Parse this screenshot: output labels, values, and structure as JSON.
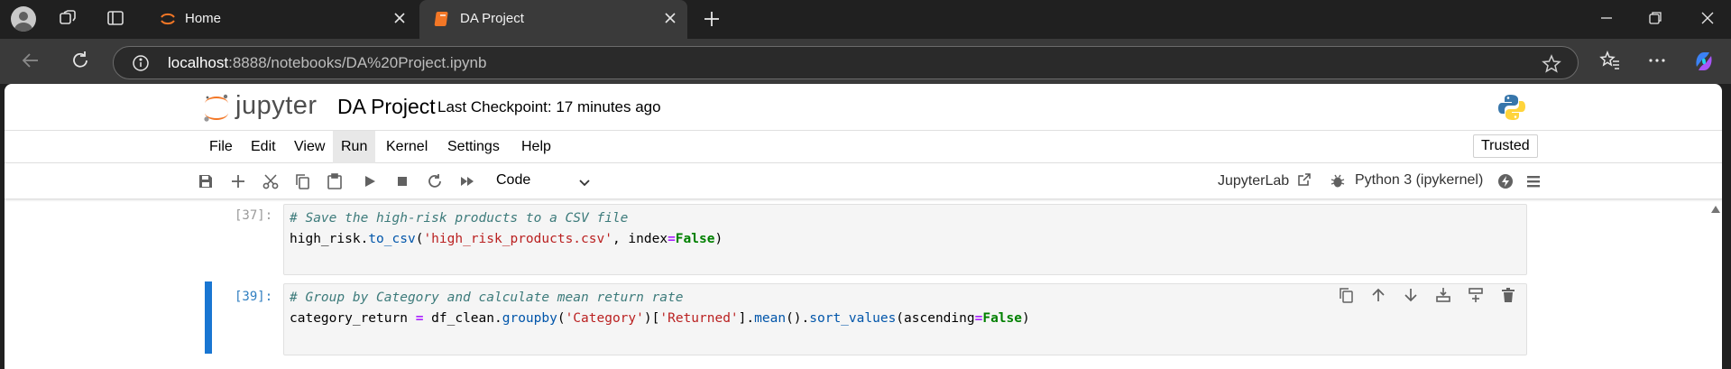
{
  "browser": {
    "tabs": [
      {
        "title": "Home"
      },
      {
        "title": "DA Project"
      }
    ],
    "url_host": "localhost",
    "url_rest": ":8888/notebooks/DA%20Project.ipynb"
  },
  "jupyter": {
    "logo_text": "jupyter",
    "notebook_title": "DA Project",
    "checkpoint": "Last Checkpoint: 17 minutes ago",
    "menu": [
      "File",
      "Edit",
      "View",
      "Run",
      "Kernel",
      "Settings",
      "Help"
    ],
    "trusted": "Trusted",
    "cell_type": "Code",
    "jupyterlab_link": "JupyterLab",
    "kernel": "Python 3 (ipykernel)"
  },
  "cells": [
    {
      "prompt": "[37]:",
      "lines": [
        [
          {
            "t": "# Save the high-risk products to a CSV file",
            "c": "comment"
          }
        ],
        [
          {
            "t": "high_risk",
            "c": ""
          },
          {
            "t": ".",
            "c": ""
          },
          {
            "t": "to_csv",
            "c": "attr"
          },
          {
            "t": "(",
            "c": ""
          },
          {
            "t": "'high_risk_products.csv'",
            "c": "str"
          },
          {
            "t": ", index",
            "c": ""
          },
          {
            "t": "=",
            "c": "op"
          },
          {
            "t": "False",
            "c": "kw"
          },
          {
            "t": ")",
            "c": ""
          }
        ]
      ]
    },
    {
      "prompt": "[39]:",
      "lines": [
        [
          {
            "t": "# Group by Category and calculate mean return rate",
            "c": "comment"
          }
        ],
        [
          {
            "t": "category_return ",
            "c": ""
          },
          {
            "t": "=",
            "c": "op"
          },
          {
            "t": " df_clean",
            "c": ""
          },
          {
            "t": ".",
            "c": ""
          },
          {
            "t": "groupby",
            "c": "attr"
          },
          {
            "t": "(",
            "c": ""
          },
          {
            "t": "'Category'",
            "c": "str"
          },
          {
            "t": ")[",
            "c": ""
          },
          {
            "t": "'Returned'",
            "c": "str"
          },
          {
            "t": "]",
            "c": ""
          },
          {
            "t": ".",
            "c": ""
          },
          {
            "t": "mean",
            "c": "attr"
          },
          {
            "t": "()",
            "c": ""
          },
          {
            "t": ".",
            "c": ""
          },
          {
            "t": "sort_values",
            "c": "attr"
          },
          {
            "t": "(ascending",
            "c": ""
          },
          {
            "t": "=",
            "c": "op"
          },
          {
            "t": "False",
            "c": "kw"
          },
          {
            "t": ")",
            "c": ""
          }
        ]
      ]
    }
  ],
  "icons": {
    "toolbar": [
      "save-icon",
      "add-cell-icon",
      "cut-icon",
      "copy-icon",
      "paste-icon",
      "run-icon",
      "stop-icon",
      "restart-icon",
      "run-all-icon"
    ],
    "cell_tools": [
      "duplicate-icon",
      "move-up-icon",
      "move-down-icon",
      "insert-above-icon",
      "insert-below-icon",
      "delete-icon"
    ]
  },
  "colors": {
    "active_cell_bar": "#1976d2",
    "active_prompt": "#307fc1",
    "jupyter_orange": "#f37726"
  }
}
